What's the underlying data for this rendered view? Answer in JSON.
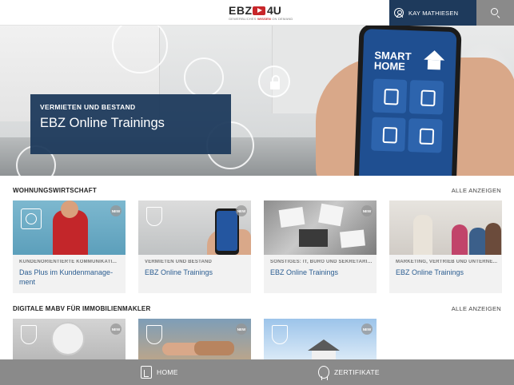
{
  "header": {
    "logo_main": "EBZ",
    "logo_tail": "4U",
    "logo_sub_a": "GEWERBLICHES ",
    "logo_sub_b": "WISSEN",
    "logo_sub_c": " ON DEMAND",
    "user_name": "KAY MATHIESEN",
    "icons": {
      "user": "user-icon",
      "search": "search-icon"
    }
  },
  "hero": {
    "eyebrow": "VERMIETEN UND BESTAND",
    "title": "EBZ Online Trainings",
    "phone_title_line1": "SMART",
    "phone_title_line2": "HOME"
  },
  "sections": [
    {
      "title": "WOHNUNGSWIRTSCHAFT",
      "link": "ALLE ANZEIGEN",
      "cards": [
        {
          "badge": "NEW",
          "category": "KUNDENORIENTIERTE KOMMUNIKATI...",
          "title": "Das Plus im Kundenmanage-ment"
        },
        {
          "badge": "NEW",
          "category": "VERMIETEN UND BESTAND",
          "title": "EBZ Online Trainings"
        },
        {
          "badge": "NEW",
          "category": "SONSTIGES: IT, BÜRO UND SEKRETARIAT",
          "title": "EBZ Online Trainings"
        },
        {
          "badge": "NEW",
          "category": "MARKETING, VERTRIEB UND UNTERNE...",
          "title": "EBZ Online Trainings"
        }
      ]
    },
    {
      "title": "DIGITALE MABV FÜR IMMOBILIENMAKLER",
      "link": "ALLE ANZEIGEN",
      "cards": [
        {
          "badge": "NEW"
        },
        {
          "badge": "NEW"
        },
        {
          "badge": "NEW"
        }
      ]
    }
  ],
  "tabbar": {
    "home_label": "HOME",
    "cert_label": "ZERTIFIKATE"
  },
  "colors": {
    "brand_navy": "#1e3a5c",
    "accent_red": "#c8262a",
    "link_blue": "#2b5d91",
    "tabbar_gray": "#8a8a8a"
  }
}
